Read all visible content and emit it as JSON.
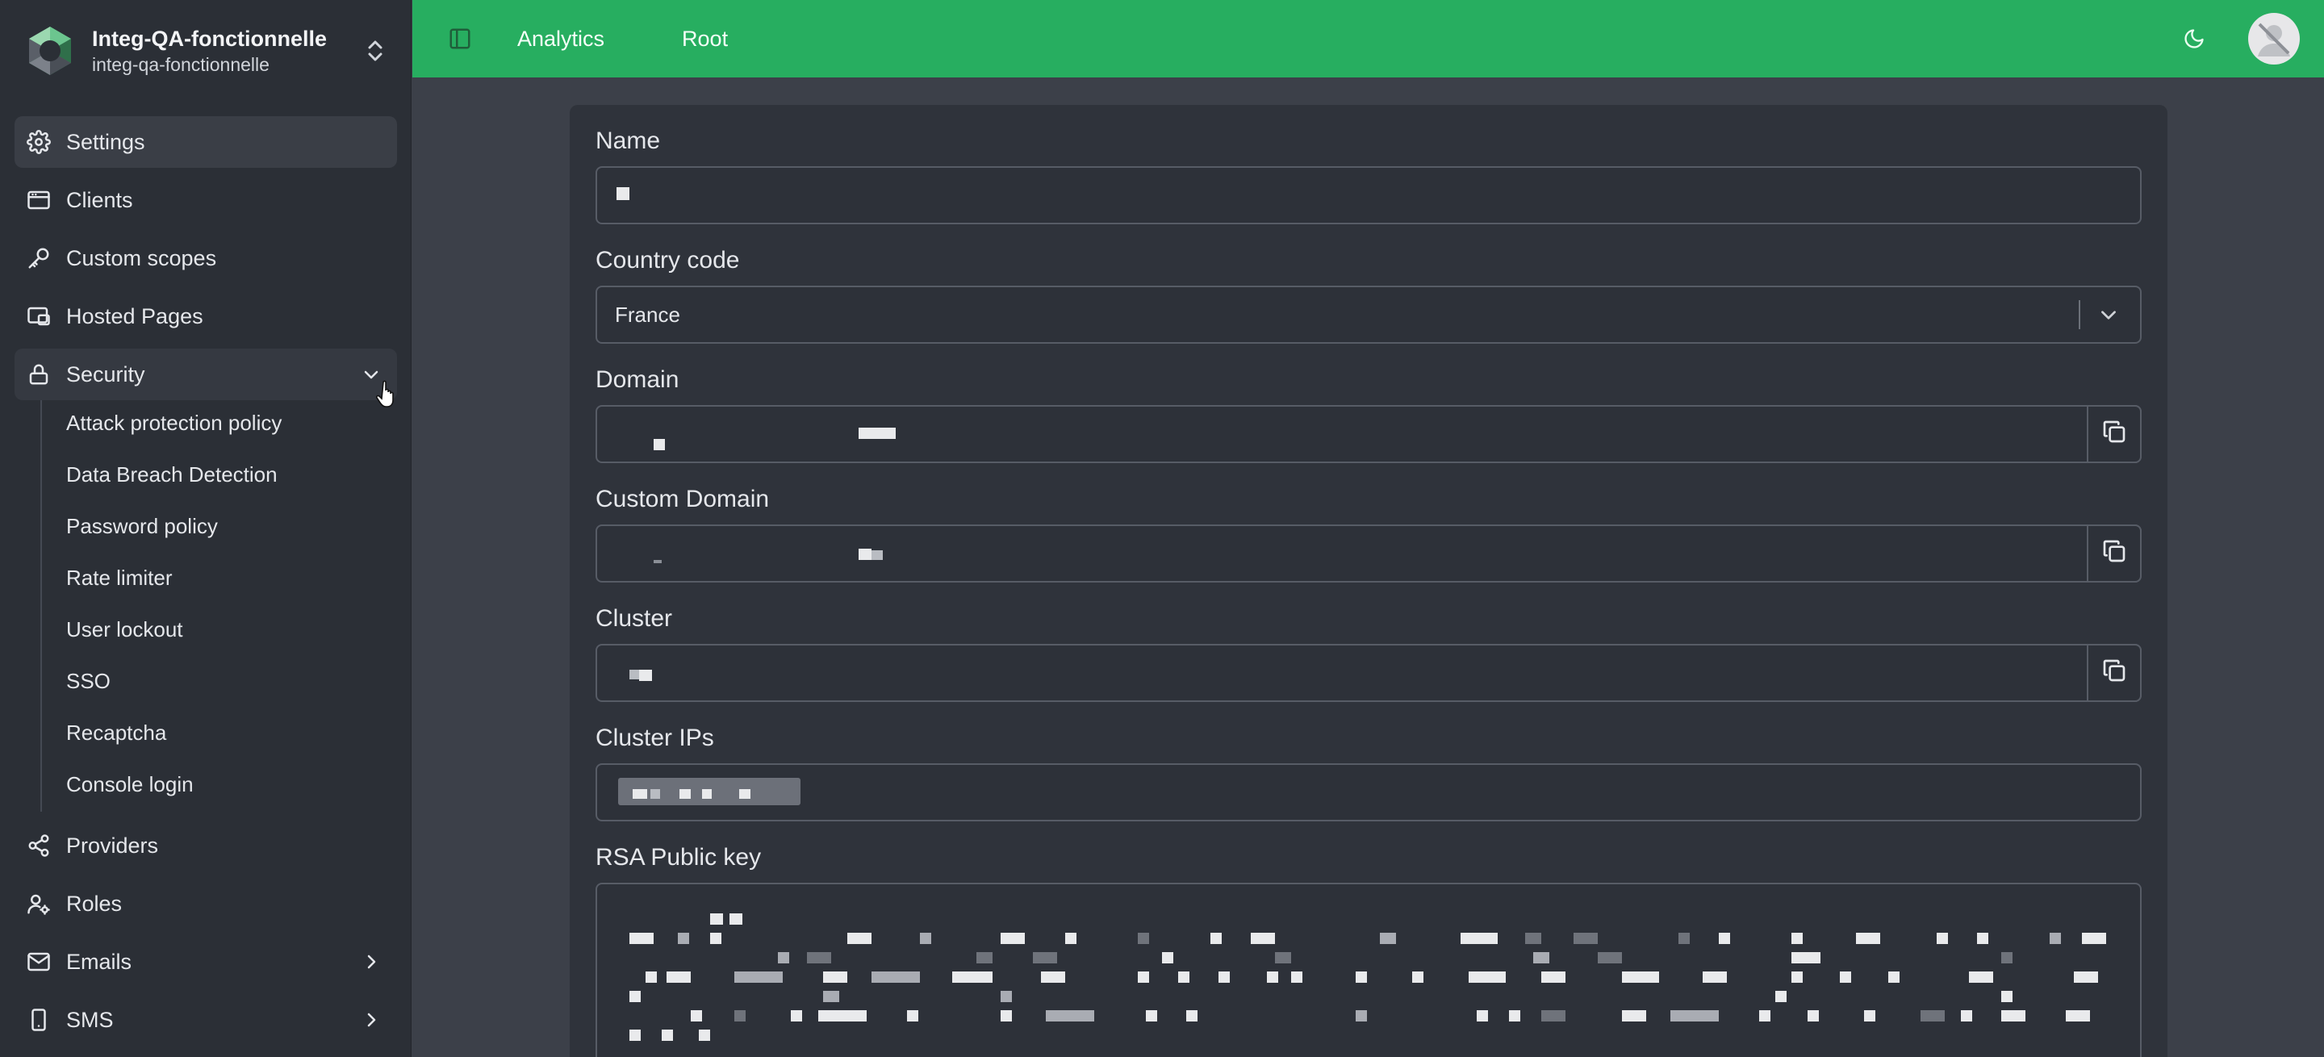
{
  "workspace": {
    "title": "Integ-QA-fonctionnelle",
    "subtitle": "integ-qa-fonctionnelle"
  },
  "sidebar": {
    "items": [
      {
        "label": "Settings",
        "icon": "gear-icon"
      },
      {
        "label": "Clients",
        "icon": "window-icon"
      },
      {
        "label": "Custom scopes",
        "icon": "key-icon"
      },
      {
        "label": "Hosted Pages",
        "icon": "pages-icon"
      },
      {
        "label": "Security",
        "icon": "lock-icon"
      },
      {
        "label": "Providers",
        "icon": "share-icon"
      },
      {
        "label": "Roles",
        "icon": "user-gear-icon"
      },
      {
        "label": "Emails",
        "icon": "mail-icon"
      },
      {
        "label": "SMS",
        "icon": "phone-icon"
      }
    ],
    "security_sub": [
      "Attack protection policy",
      "Data Breach Detection",
      "Password policy",
      "Rate limiter",
      "User lockout",
      "SSO",
      "Recaptcha",
      "Console login"
    ]
  },
  "topbar": {
    "links": [
      "Analytics",
      "Root"
    ],
    "accent": "#27ae60"
  },
  "form": {
    "name_label": "Name",
    "country_label": "Country code",
    "country_value": "France",
    "domain_label": "Domain",
    "custom_domain_label": "Custom Domain",
    "cluster_label": "Cluster",
    "cluster_ips_label": "Cluster IPs",
    "rsa_label": "RSA Public key"
  }
}
